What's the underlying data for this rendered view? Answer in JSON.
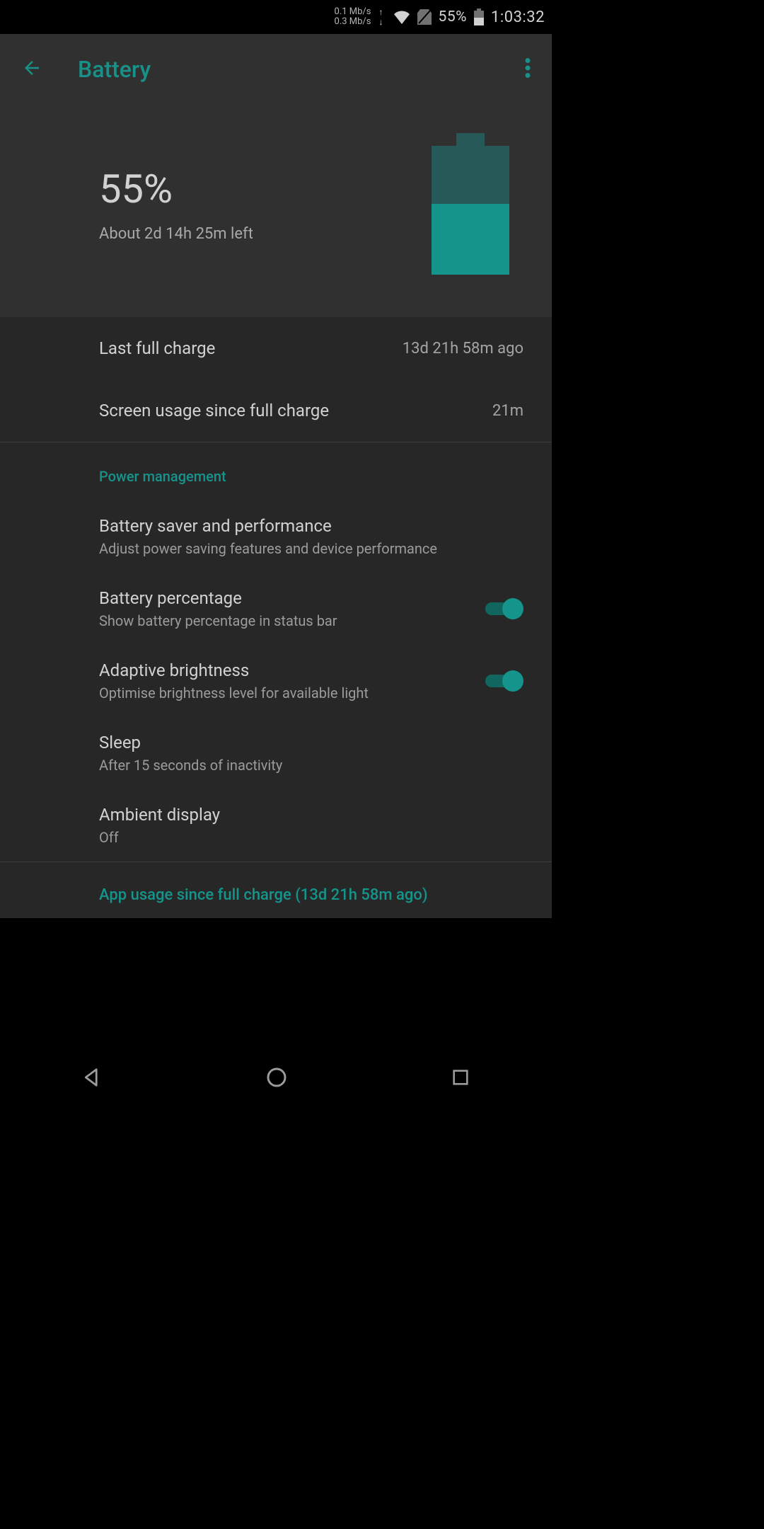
{
  "status": {
    "net_up": "0.1 Mb/s",
    "net_down": "0.3 Mb/s",
    "battery_pct": "55%",
    "clock": "1:03:32"
  },
  "appbar": {
    "title": "Battery"
  },
  "hero": {
    "pct": "55%",
    "estimate": "About 2d 14h 25m left",
    "fill_pct": 55
  },
  "stats": {
    "last_charge_label": "Last full charge",
    "last_charge_value": "13d 21h 58m ago",
    "screen_usage_label": "Screen usage since full charge",
    "screen_usage_value": "21m"
  },
  "sections": {
    "power_mgmt": "Power management",
    "app_usage": "App usage since full charge (13d 21h 58m ago)"
  },
  "settings": {
    "saver": {
      "title": "Battery saver and performance",
      "sub": "Adjust power saving features and device performance"
    },
    "pct": {
      "title": "Battery percentage",
      "sub": "Show battery percentage in status bar",
      "on": true
    },
    "adaptive": {
      "title": "Adaptive brightness",
      "sub": "Optimise brightness level for available light",
      "on": true
    },
    "sleep": {
      "title": "Sleep",
      "sub": "After 15 seconds of inactivity"
    },
    "ambient": {
      "title": "Ambient display",
      "sub": "Off"
    }
  }
}
